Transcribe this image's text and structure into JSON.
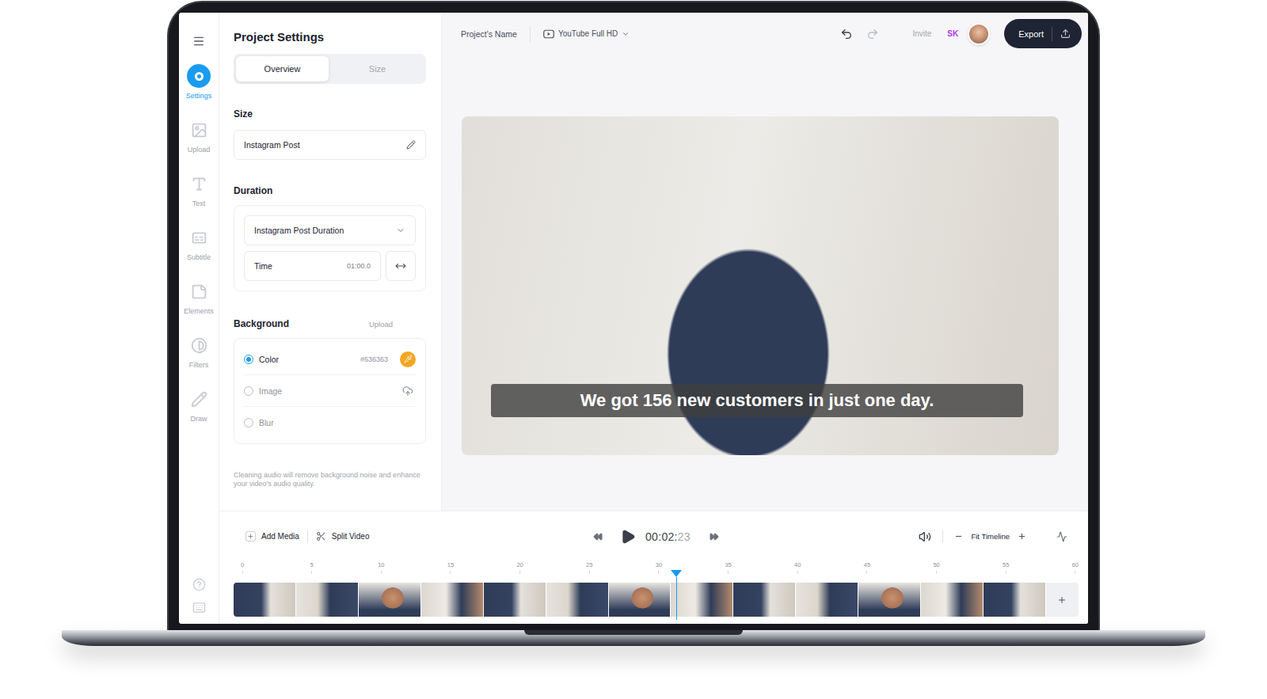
{
  "sidebar": {
    "items": [
      {
        "label": "Settings",
        "selected": true
      },
      {
        "label": "Upload",
        "selected": false
      },
      {
        "label": "Text",
        "selected": false
      },
      {
        "label": "Subtitle",
        "selected": false
      },
      {
        "label": "Elements",
        "selected": false
      },
      {
        "label": "Filters",
        "selected": false
      },
      {
        "label": "Draw",
        "selected": false
      }
    ]
  },
  "settings": {
    "title": "Project Settings",
    "tabs": [
      {
        "label": "Overview",
        "selected": true
      },
      {
        "label": "Size",
        "selected": false
      }
    ],
    "size": {
      "label": "Size",
      "value": "Instagram Post"
    },
    "duration": {
      "label": "Duration",
      "preset": "Instagram Post Duration",
      "time_label": "Time",
      "time_value": "01:00.0"
    },
    "background": {
      "label": "Background",
      "upload": "Upload",
      "options": [
        {
          "kind": "color",
          "label": "Color",
          "value": "#636363",
          "selected": true
        },
        {
          "kind": "image",
          "label": "Image",
          "selected": false
        },
        {
          "kind": "blur",
          "label": "Blur",
          "selected": false
        }
      ]
    },
    "note": "Cleaning audio will remove background noise and enhance your video's audio quality."
  },
  "topbar": {
    "project_name": "Project's Name",
    "format": "YouTube Full HD",
    "undo_disabled": false,
    "redo_disabled": true,
    "invite": "Invite",
    "user_initials": "SK",
    "export": "Export"
  },
  "preview": {
    "subtitle": "We got 156 new customers in just one day."
  },
  "timeline": {
    "add_media": "Add Media",
    "split_video": "Split Video",
    "time": "00:02:",
    "time_frames": "23",
    "zoom": "Fit Timeline",
    "ruler": [
      "0",
      "5",
      "10",
      "15",
      "20",
      "25",
      "30",
      "35",
      "40",
      "45",
      "50",
      "55",
      "60"
    ],
    "playhead": {
      "level": 0.521
    }
  }
}
